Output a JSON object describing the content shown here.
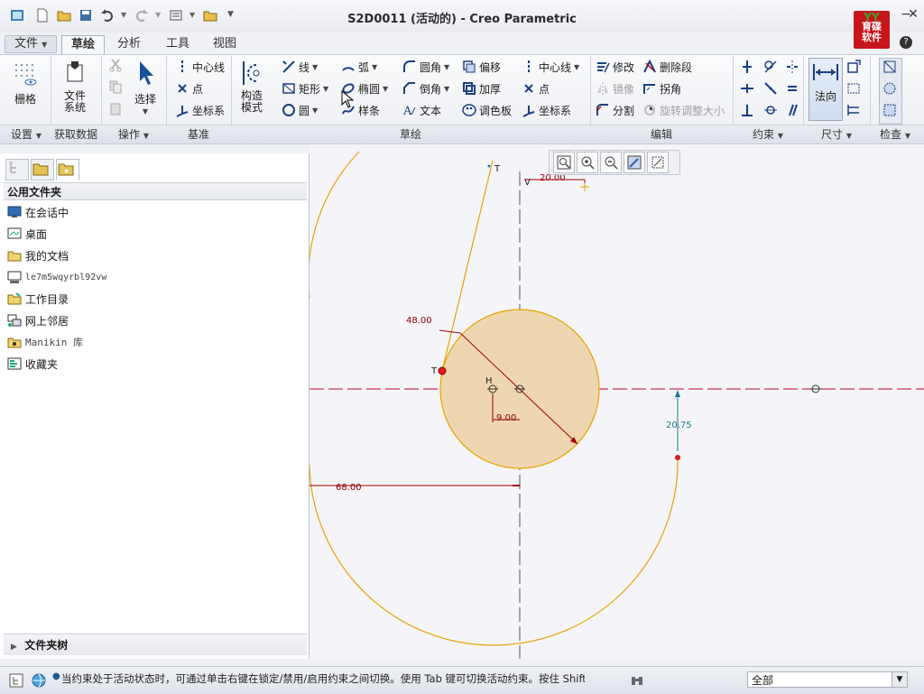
{
  "window": {
    "title": "S2D0011 (活动的) - Creo Parametric",
    "logo_text": "育碟软件"
  },
  "tabs": [
    {
      "label": "文件",
      "menu": true
    },
    {
      "label": "草绘",
      "active": true
    },
    {
      "label": "分析"
    },
    {
      "label": "工具"
    },
    {
      "label": "视图"
    }
  ],
  "ribbon": {
    "setup": {
      "grid": "栅格"
    },
    "getdata": {
      "file_system": "文件\n系统"
    },
    "ops": {
      "select": "选择"
    },
    "datum": {
      "centerline": "中心线",
      "point": "点",
      "coordsys": "坐标系",
      "construction_mode": "构造\n模式"
    },
    "sketch": {
      "line": "线",
      "arc": "弧",
      "fillet": "圆角",
      "offset": "偏移",
      "centerline": "中心线",
      "rectangle": "矩形",
      "ellipse": "椭圆",
      "chamfer": "倒角",
      "thicken": "加厚",
      "point": "点",
      "circle": "圆",
      "spline": "样条",
      "text": "文本",
      "palette": "调色板",
      "coordsys": "坐标系"
    },
    "edit": {
      "modify": "修改",
      "delete_segment": "删除段",
      "mirror": "镜像",
      "corner": "拐角",
      "divide": "分割",
      "rotate_resize": "旋转调整大小"
    },
    "normal": "法向",
    "groups": [
      "设置",
      "获取数据",
      "操作",
      "基准",
      "草绘",
      "编辑",
      "约束",
      "尺寸",
      "检查"
    ]
  },
  "folder_panel": {
    "header": "公用文件夹",
    "items": [
      "在会话中",
      "桌面",
      "我的文档",
      "le7m5wqyrbl92vw",
      "工作目录",
      "网上邻居",
      "Manikin 库",
      "收藏夹"
    ],
    "tree_label": "文件夹树"
  },
  "sketch": {
    "dimensions": {
      "top": "20.00",
      "diameter": "48.00",
      "h_offset": "9.00",
      "v_offset": "20.75",
      "horizontal": "68.00"
    },
    "labels": {
      "tangent1": "T",
      "tangent2": "T",
      "horizontal": "H",
      "vertical": "V"
    },
    "colors": {
      "geometry": "#e8a200",
      "dimension": "#a00000",
      "circle_fill": "#eed7b0",
      "centerline": "#c2002a",
      "blue_dim": "#1a7a8c"
    }
  },
  "status": {
    "message": "当约束处于活动状态时，可通过单击右键在锁定/禁用/启用约束之间切换。使用 Tab 键可切换活动约束。按住 Shift",
    "filter": "全部"
  }
}
